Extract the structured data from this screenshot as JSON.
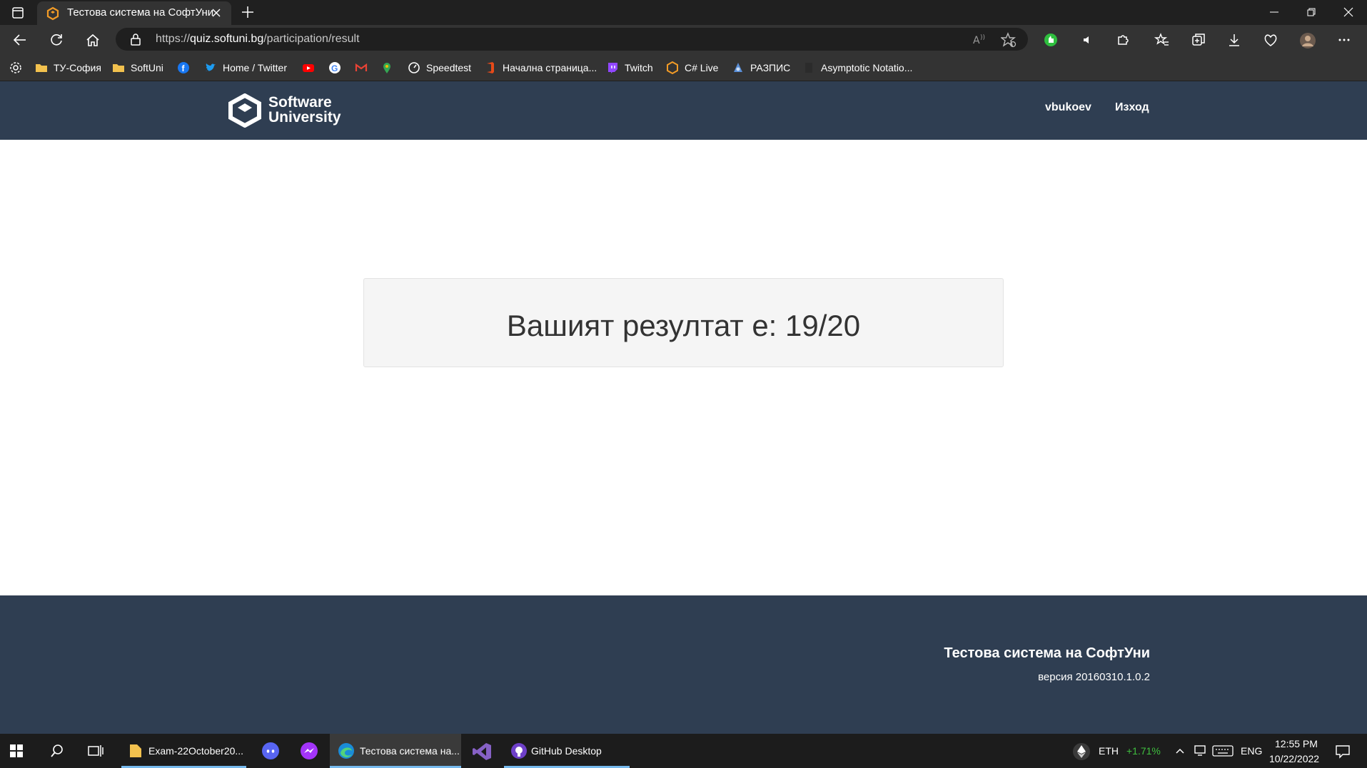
{
  "browser": {
    "tab_title": "Тестова система на СофтУни",
    "url_scheme": "https://",
    "url_host": "quiz.softuni.bg",
    "url_path": "/participation/result"
  },
  "bookmarks": [
    {
      "label": "ТУ-София",
      "icon": "folder-icon"
    },
    {
      "label": "SoftUni",
      "icon": "folder-icon"
    },
    {
      "label": "",
      "icon": "facebook-icon"
    },
    {
      "label": "Home / Twitter",
      "icon": "twitter-icon"
    },
    {
      "label": "",
      "icon": "youtube-icon"
    },
    {
      "label": "",
      "icon": "google-icon"
    },
    {
      "label": "",
      "icon": "gmail-icon"
    },
    {
      "label": "",
      "icon": "maps-icon"
    },
    {
      "label": "Speedtest",
      "icon": "speedtest-icon"
    },
    {
      "label": "Начална страница...",
      "icon": "office-icon"
    },
    {
      "label": "Twitch",
      "icon": "twitch-icon"
    },
    {
      "label": "C# Live",
      "icon": "softuni-icon"
    },
    {
      "label": "РАЗПИС",
      "icon": "raspis-icon"
    },
    {
      "label": "Asymptotic Notatio...",
      "icon": "page-icon"
    }
  ],
  "site": {
    "logo_line1": "Software",
    "logo_line2": "University",
    "user": "vbukoev",
    "logout": "Изход"
  },
  "result": {
    "text": "Вашият резултат е: 19/20"
  },
  "footer": {
    "title": "Тестова система на СофтУни",
    "version": "версия 20160310.1.0.2"
  },
  "taskbar": {
    "apps": [
      {
        "label": "Exam-22October20..."
      },
      {
        "label": "Тестова система на..."
      },
      {
        "label": "GitHub Desktop"
      }
    ],
    "crypto": "ETH",
    "crypto_change": "+1.71%",
    "lang": "ENG",
    "time": "12:55 PM",
    "date": "10/22/2022"
  },
  "colors": {
    "header_bg": "#2f3e52",
    "result_bg": "#f5f5f5",
    "crypto_up": "#3fbf3f"
  }
}
